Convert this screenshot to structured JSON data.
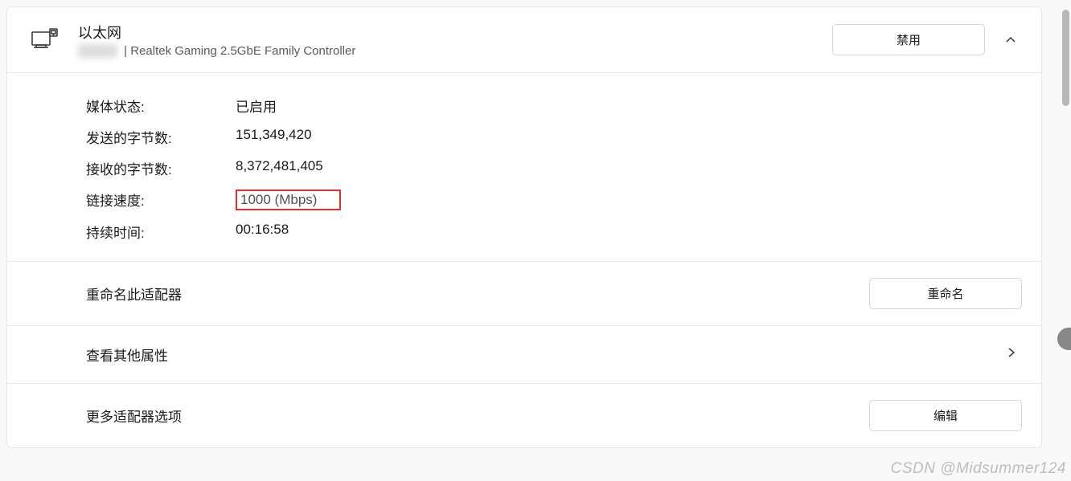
{
  "header": {
    "title": "以太网",
    "blurred_text": "xxxxxx",
    "subtitle_suffix": "| Realtek Gaming 2.5GbE Family Controller",
    "disable_button": "禁用"
  },
  "details": {
    "media_state": {
      "label": "媒体状态:",
      "value": "已启用"
    },
    "bytes_sent": {
      "label": "发送的字节数:",
      "value": "151,349,420"
    },
    "bytes_received": {
      "label": "接收的字节数:",
      "value": "8,372,481,405"
    },
    "link_speed": {
      "label": "链接速度:",
      "value": "1000 (Mbps)"
    },
    "duration": {
      "label": "持续时间:",
      "value": "00:16:58"
    }
  },
  "actions": {
    "rename": {
      "label": "重命名此适配器",
      "button": "重命名"
    },
    "view_props": {
      "label": "查看其他属性"
    },
    "more_options": {
      "label": "更多适配器选项",
      "button": "编辑"
    }
  },
  "watermark": "CSDN @Midsummer124"
}
